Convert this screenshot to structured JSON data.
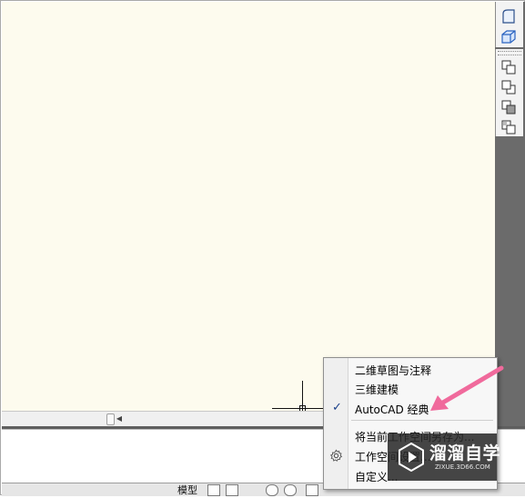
{
  "canvas": {
    "background": "#fdfbee"
  },
  "right_toolbar": {
    "icons": [
      "surface-icon",
      "box-3d-icon",
      "layer-front-icon",
      "layer-back-icon",
      "layer-above-icon",
      "layer-below-icon"
    ]
  },
  "statusbar": {
    "model_tab": "模型"
  },
  "context_menu": {
    "items": [
      {
        "label": "二维草图与注释",
        "checked": false
      },
      {
        "label": "三维建模",
        "checked": false
      },
      {
        "label": "AutoCAD 经典",
        "checked": true
      },
      {
        "label": "将当前工作空间另存为...",
        "checked": false
      },
      {
        "label": "工作空间设置...",
        "checked": false
      },
      {
        "label": "自定义...",
        "checked": false
      }
    ],
    "check_glyph": "✓"
  },
  "watermark": {
    "title": "溜溜自学",
    "subtitle": "ZIXUE.3D66.COM"
  },
  "colors": {
    "arrow": "#f06a9c",
    "menu_bg": "#f7f7f7",
    "toolbar_dark": "#6b6b6b"
  }
}
